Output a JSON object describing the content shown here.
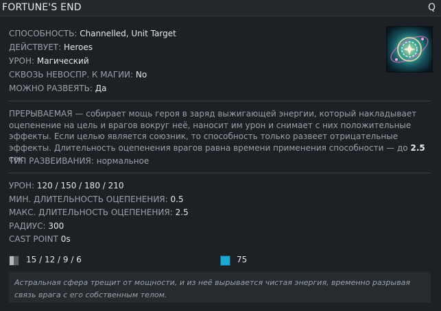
{
  "header": {
    "title": "FORTUNE'S END",
    "hotkey": "Q"
  },
  "ability": {
    "icon_name": "fortunes-end-orb-icon",
    "attributes": [
      {
        "label": "СПОСОБНОСТЬ:",
        "value": "Channelled, Unit Target"
      },
      {
        "label": "ДЕЙСТВУЕТ:",
        "value": "Heroes"
      },
      {
        "label": "УРОН:",
        "value": "Магический"
      },
      {
        "label": "СКВОЗЬ НЕВОСПР. К МАГИИ:",
        "value": "No"
      },
      {
        "label": "МОЖНО РАЗВЕЯТЬ:",
        "value": "Да"
      }
    ],
    "description": {
      "text": "ПРЕРЫВАЕМАЯ — собирает мощь героя в заряд выжигающей энергии, который накладывает оцепенение на цель и врагов вокруг неё, наносит им урон и снимает с них положительные эффекты. Если целью является союзник, то способность только развеет отрицательные эффекты. Длительность оцепенения врагов равна времени применения способности — до",
      "highlight": "2.5",
      "suffix": "сек."
    },
    "dispel": {
      "label": "ТИП РАЗВЕИВАНИЯ:",
      "value": "нормальное"
    },
    "stats": [
      {
        "label": "УРОН:",
        "value": "120 / 150 / 180 / 210"
      },
      {
        "label": "МИН. ДЛИТЕЛЬНОСТЬ ОЦЕПЕНЕНИЯ:",
        "value": "0.5"
      },
      {
        "label": "МАКС. ДЛИТЕЛЬНОСТЬ ОЦЕПЕНЕНИЯ:",
        "value": "2.5"
      },
      {
        "label": "РАДИУС:",
        "value": "300"
      },
      {
        "label": "CAST POINT",
        "value": "0s"
      }
    ],
    "cooldown": "15 / 12 / 9 / 6",
    "mana_cost": "75",
    "lore": "Астральная сфера трещит от мощности, и из неё вырывается чистая энергия, временно разрывая связь врага с его собственным телом."
  },
  "colors": {
    "background": "#1d2125",
    "label": "#9aa2a9",
    "value": "#e6e9ec",
    "mana": "#1ea6d0"
  }
}
